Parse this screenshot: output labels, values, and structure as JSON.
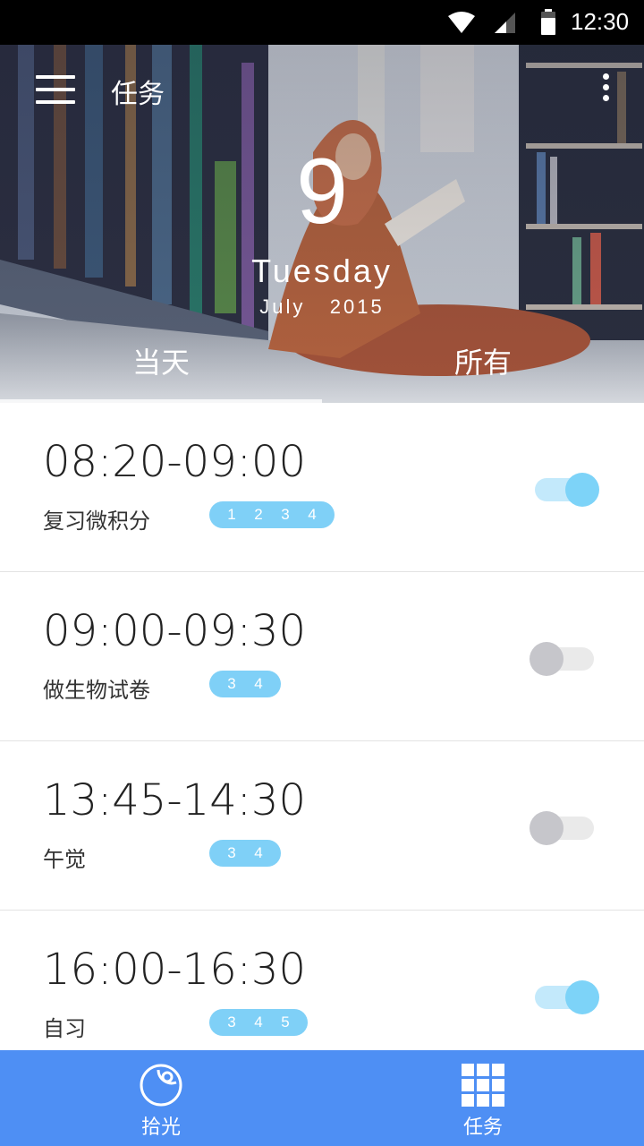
{
  "status_bar": {
    "time": "12:30",
    "icons": [
      "wifi-icon",
      "cell-signal-icon",
      "battery-icon"
    ]
  },
  "header": {
    "title": "任务",
    "menu_icon": "hamburger-menu-icon",
    "more_icon": "more-vertical-icon",
    "date": {
      "day": "9",
      "weekday": "Tuesday",
      "month_year": "July   2015"
    },
    "tabs": [
      {
        "label": "当天",
        "selected": true
      },
      {
        "label": "所有",
        "selected": false
      }
    ]
  },
  "tasks": [
    {
      "time": "08:20-09:00",
      "name": "复习微积分",
      "days": [
        "1",
        "2",
        "3",
        "4"
      ],
      "enabled": true
    },
    {
      "time": "09:00-09:30",
      "name": "做生物试卷",
      "days": [
        "3",
        "4"
      ],
      "enabled": false
    },
    {
      "time": "13:45-14:30",
      "name": "午觉",
      "days": [
        "3",
        "4"
      ],
      "enabled": false
    },
    {
      "time": "16:00-16:30",
      "name": "自习",
      "days": [
        "3",
        "4",
        "5"
      ],
      "enabled": true
    }
  ],
  "bottom_nav": {
    "items": [
      {
        "label": "拾光",
        "icon": "light-circle-icon"
      },
      {
        "label": "任务",
        "icon": "grid-icon"
      }
    ]
  },
  "colors": {
    "accent": "#4e8ff4",
    "chip": "#7fd0f7",
    "toggle_on": "#7dd3f8",
    "toggle_off": "#c6c6cb"
  }
}
